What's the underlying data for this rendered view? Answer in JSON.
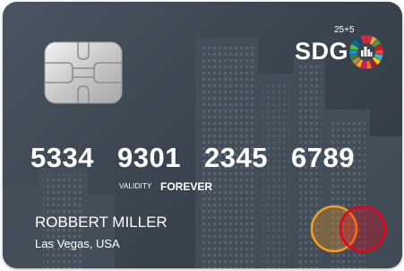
{
  "card": {
    "brand": "SDG",
    "brand_superscript": "25+5",
    "number_groups": [
      "5334",
      "9301",
      "2345",
      "6789"
    ],
    "validity_label": "VALIDITY",
    "validity_value": "FOREVER",
    "holder_name": "ROBBERT MILLER",
    "holder_location": "Las Vegas, USA",
    "network_logo": "mastercard-logo-icon",
    "chip_icon": "emv-chip-icon",
    "sdg_icon": "sdg-color-wheel-icon"
  },
  "colors": {
    "card_background": "#3c4651",
    "text": "#ffffff",
    "mastercard_red": "#eb001b",
    "mastercard_orange": "#f79e1b"
  }
}
